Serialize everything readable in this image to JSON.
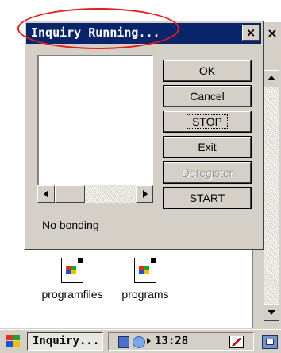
{
  "dialog": {
    "title": "Inquiry Running...",
    "close_glyph": "×",
    "status": "No bonding",
    "buttons": [
      {
        "label": "OK",
        "enabled": true
      },
      {
        "label": "Cancel",
        "enabled": true
      },
      {
        "label": "STOP",
        "enabled": true,
        "focused": true
      },
      {
        "label": "Exit",
        "enabled": true
      },
      {
        "label": "Deregister",
        "enabled": false
      },
      {
        "label": "START",
        "enabled": true
      }
    ]
  },
  "background_window": {
    "close_glyph": "×"
  },
  "desktop": {
    "icons": [
      {
        "label": "programfiles",
        "icon": "program-file-icon"
      },
      {
        "label": "programs",
        "icon": "program-file-icon"
      }
    ]
  },
  "taskbar": {
    "task_label": "Inquiry...",
    "clock": "13:28"
  },
  "annotation": {
    "color": "#e02020"
  },
  "colors": {
    "titlebar": "#0a246a",
    "face": "#d4d0c8"
  }
}
